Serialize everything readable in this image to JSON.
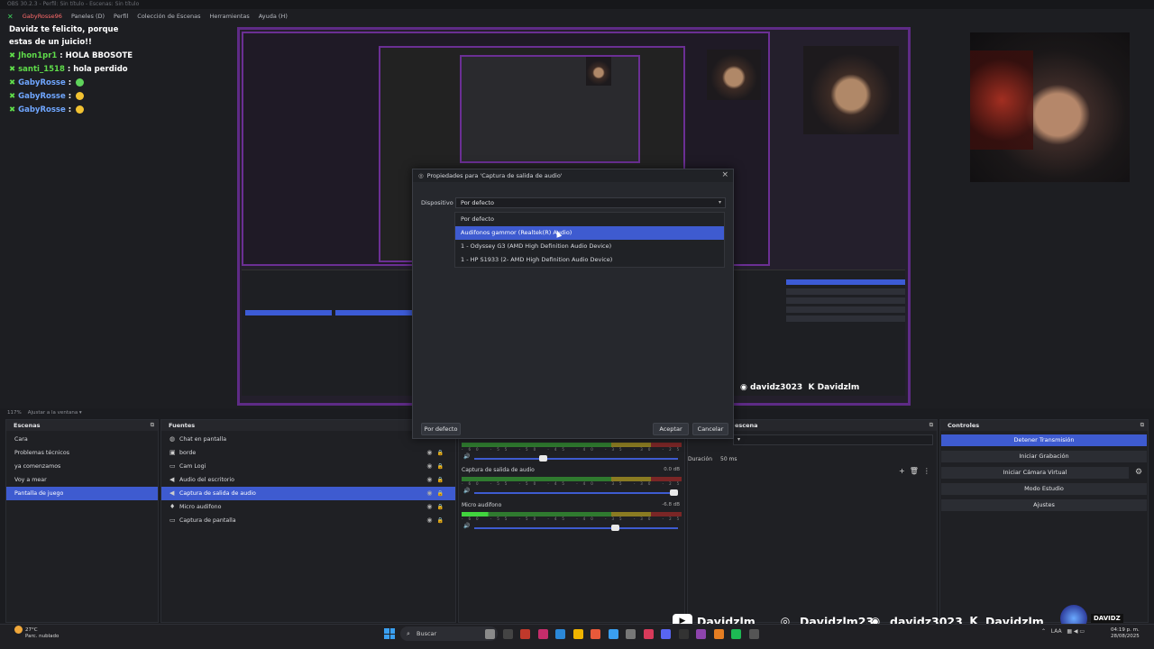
{
  "window": {
    "title_strip": "OBS 30.2.3 - Perfil: Sin título - Escenas: Sin título"
  },
  "menubar": {
    "logo": "✕",
    "items": [
      "GabyRosse96",
      "Paneles (D)",
      "Perfil",
      "Colección de Escenas",
      "Herramientas",
      "Ayuda (H)"
    ]
  },
  "chat": [
    {
      "user": "",
      "text": "Davidz te felicito, porque estas de un juicio!!"
    },
    {
      "user": "Jhon1pr1",
      "sep": " : ",
      "text": "HOLA BBOSOTE",
      "color": "green"
    },
    {
      "user": "santi_1518",
      "sep": " : ",
      "text": "hola perdido",
      "color": "green"
    },
    {
      "user": "GabyRosse",
      "sep": " : ",
      "text": "",
      "color": "blue",
      "emote": "green"
    },
    {
      "user": "GabyRosse",
      "sep": " : ",
      "text": "",
      "color": "blue",
      "emote": "yellow"
    },
    {
      "user": "GabyRosse",
      "sep": " : ",
      "text": "",
      "color": "blue",
      "emote": "yellow"
    }
  ],
  "preview_socials": {
    "discord": "davidz3023",
    "kick": "Davidzlm"
  },
  "zoom": {
    "value": "117%",
    "fit": "Ajustar a la ventana"
  },
  "dialog": {
    "title": "Propiedades para 'Captura de salida de audio'",
    "device_label": "Dispositivo",
    "device_value": "Por defecto",
    "options": [
      "Por defecto",
      "Audifonos gammor (Realtek(R) Audio)",
      "1 - Odyssey G3 (AMD High Definition Audio Device)",
      "1 - HP S1933 (2- AMD High Definition Audio Device)"
    ],
    "selected_index": 1,
    "defaults_button": "Por defecto",
    "accept_button": "Aceptar",
    "cancel_button": "Cancelar"
  },
  "scenes": {
    "title": "Escenas",
    "items": [
      "Cara",
      "Problemas técnicos",
      "ya comenzamos",
      "Voy a mear",
      "Pantalla de juego"
    ],
    "selected_index": 4
  },
  "sources": {
    "title": "Fuentes",
    "items": [
      {
        "label": "Chat en pantalla",
        "icon": "browser-icon",
        "glyph": "◍",
        "controls": false
      },
      {
        "label": "borde",
        "icon": "image-icon",
        "glyph": "▣",
        "controls": true
      },
      {
        "label": "Cam Logi",
        "icon": "camera-icon",
        "glyph": "▭",
        "controls": true
      },
      {
        "label": "Audio del escritorio",
        "icon": "speaker-icon",
        "glyph": "◀",
        "controls": true
      },
      {
        "label": "Captura de salida de audio",
        "icon": "speaker-icon",
        "glyph": "◀",
        "controls": true
      },
      {
        "label": "Micro audifono",
        "icon": "mic-icon",
        "glyph": "♦",
        "controls": true
      },
      {
        "label": "Captura de pantalla",
        "icon": "monitor-icon",
        "glyph": "▭",
        "controls": true
      }
    ],
    "selected_index": 4
  },
  "mixer": {
    "scale": "-60 -55 -50 -45 -40 -35 -30 -25 -20 -15 -10 -5 0",
    "tracks": [
      {
        "name": "",
        "db": "",
        "fader": 0.33
      },
      {
        "name": "Captura de salida de audio",
        "db": "0.0 dB",
        "fader": 1.0
      },
      {
        "name": "Micro audifono",
        "db": "-6.8 dB",
        "fader": 0.7
      }
    ]
  },
  "transitions": {
    "title": "escena",
    "duration_label": "Duración",
    "duration_value": "50 ms"
  },
  "controls": {
    "title": "Controles",
    "buttons": [
      "Detener Transmisión",
      "Iniciar Grabación",
      "Iniciar Cámara Virtual",
      "Modo Estudio",
      "Ajustes"
    ]
  },
  "socials": {
    "youtube": "Davidzlm",
    "instagram": "Davidzlm23",
    "discord": "davidz3023",
    "kick": "Davidzlm",
    "badge": "DAVIDZ"
  },
  "taskbar": {
    "weather_temp": "27°C",
    "weather_desc": "Parc. nublado",
    "search": "Buscar",
    "lang": "LAA",
    "time": "04:19 p. m.",
    "date": "28/08/2025"
  },
  "colors": {
    "accent": "#3e5bd0",
    "preview_border": "#5e2b86",
    "chat_green": "#5fdc4a",
    "chat_blue": "#6fa6ff"
  }
}
